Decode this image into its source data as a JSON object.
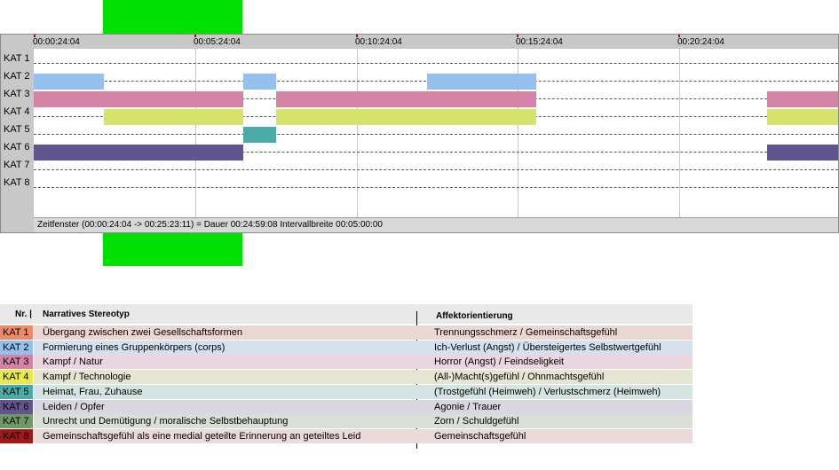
{
  "timeline": {
    "ticks": [
      "00:00:24:04",
      "00:05:24:04",
      "00:10:24:04",
      "00:15:24:04",
      "00:20:24:04"
    ],
    "rows": [
      "KAT 1",
      "KAT 2",
      "KAT 3",
      "KAT 4",
      "KAT 5",
      "KAT 6",
      "KAT 7",
      "KAT 8"
    ],
    "status": "Zeitfenster (00:00:24:04 -> 00:25:23:11) = Dauer 00:24:59:08     Intervallbreite 00:05:00:00",
    "colors": {
      "KAT 2": "#94c0ee",
      "KAT 3": "#d483a6",
      "KAT 4": "#d6e26a",
      "KAT 5": "#4aaba8",
      "KAT 6": "#62548f"
    }
  },
  "legend": {
    "header": {
      "nr": "Nr. |",
      "narrative": "Narratives Stereotyp",
      "affect": "Affektorientierung"
    },
    "rows": [
      {
        "kat": "KAT 1",
        "narrative": "Übergang zwischen zwei Gesellschaftsformen",
        "affect": "Trennungsschmerz / Gemeinschaftsgefühl",
        "kat_color": "#f08a62",
        "band_color": "#ecd6d2"
      },
      {
        "kat": "KAT 2",
        "narrative": "Formierung eines Gruppenkörpers (corps)",
        "affect": "Ich-Verlust (Angst) / Übersteigertes Selbstwertgefühl",
        "kat_color": "#94c0ee",
        "band_color": "#d6e0ec"
      },
      {
        "kat": "KAT 3",
        "narrative": "Kampf / Natur",
        "affect": "Horror (Angst) / Feindseligkeit",
        "kat_color": "#d483a6",
        "band_color": "#ead6de"
      },
      {
        "kat": "KAT 4",
        "narrative": "Kampf / Technologie",
        "affect": "(All-)Macht(s)gefühl / Ohnmachtsgefühl",
        "kat_color": "#e8ea4a",
        "band_color": "#e4e6d2"
      },
      {
        "kat": "KAT 5",
        "narrative": "Heimat, Frau, Zuhause",
        "affect": "(Trostgefühl (Heimweh) / Verlustschmerz (Heimweh)",
        "kat_color": "#4aaba8",
        "band_color": "#d4e4e2"
      },
      {
        "kat": "KAT 6",
        "narrative": "Leiden / Opfer",
        "affect": "Agonie / Trauer",
        "kat_color": "#62548f",
        "band_color": "#d8d6e0"
      },
      {
        "kat": "KAT 7",
        "narrative": "Unrecht und Demütigung / moralische Selbstbehauptung",
        "affect": "Zorn / Schuldgefühl",
        "kat_color": "#6f9a66",
        "band_color": "#d8e0d6"
      },
      {
        "kat": "KAT 8",
        "narrative": "Gemeinschaftsgefühl als eine medial geteilte Erinnerung an geteiltes Leid",
        "affect": "Gemeinschaftsgefühl",
        "kat_color": "#a01818",
        "band_color": "#eadada"
      }
    ]
  }
}
